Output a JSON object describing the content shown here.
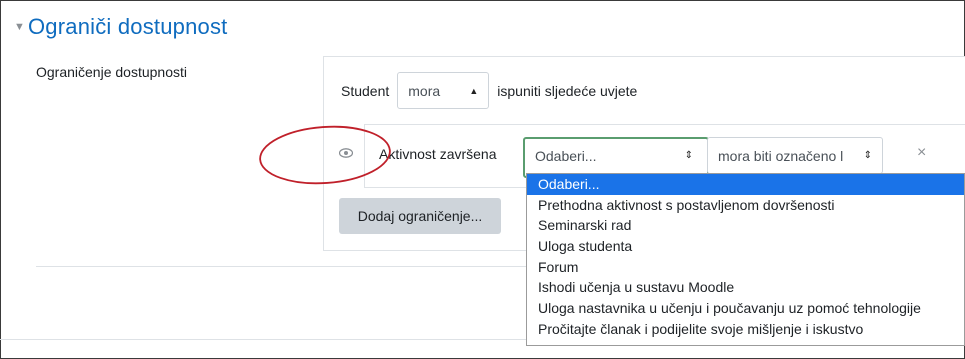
{
  "section": {
    "title": "Ograniči dostupnost"
  },
  "field": {
    "label": "Ograničenje dostupnosti"
  },
  "rule": {
    "subject": "Student",
    "mode_value": "mora",
    "suffix": "ispuniti sljedeće uvjete"
  },
  "condition": {
    "label": "Aktivnost završena",
    "activity_value": "Odaberi...",
    "state_value": "mora biti označeno l",
    "close_symbol": "×"
  },
  "add_button_label": "Dodaj ograničenje...",
  "dropdown": {
    "options": [
      "Odaberi...",
      "Prethodna aktivnost s postavljenom dovršenosti",
      "Seminarski rad",
      "Uloga studenta",
      "Forum",
      "Ishodi učenja u sustavu Moodle",
      "Uloga nastavnika u učenju i poučavanju uz pomoć tehnologije",
      "Pročitajte članak i podijelite svoje mišljenje i iskustvo"
    ],
    "highlighted_index": 0
  },
  "colors": {
    "title": "#0f6cbf",
    "highlight": "#1a73e8",
    "focus_border": "#5a9d6f",
    "annotation": "#c0202a"
  },
  "icons": {
    "collapse": "chevron-down-icon",
    "visibility": "eye-icon",
    "close": "close-icon"
  }
}
